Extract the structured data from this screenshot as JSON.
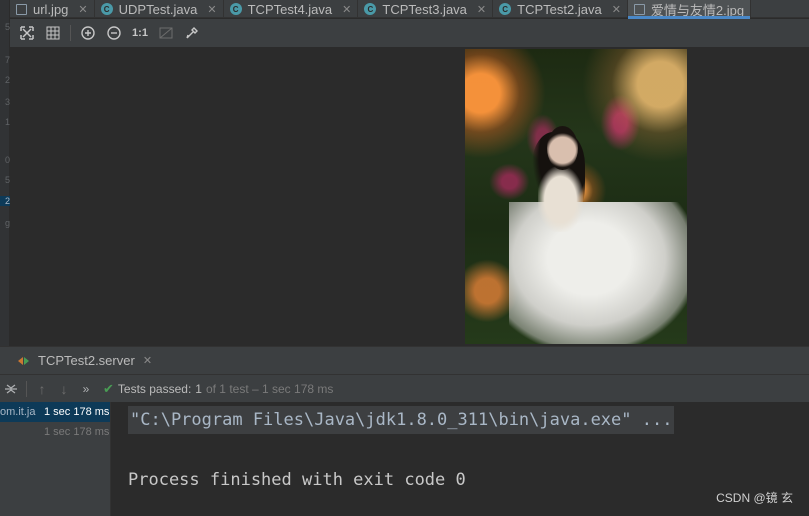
{
  "gutter": {
    "digits": [
      "5",
      "7",
      "2",
      "3",
      "1",
      "0",
      "5",
      "2",
      "g"
    ]
  },
  "tabs": [
    {
      "label": "url.jpg",
      "kind": "image",
      "active": false
    },
    {
      "label": "UDPTest.java",
      "kind": "java",
      "active": false
    },
    {
      "label": "TCPTest4.java",
      "kind": "java",
      "active": false
    },
    {
      "label": "TCPTest3.java",
      "kind": "java",
      "active": false
    },
    {
      "label": "TCPTest2.java",
      "kind": "java",
      "active": false
    },
    {
      "label": "爱情与友情2.jpg",
      "kind": "image",
      "active": true
    }
  ],
  "viewer_toolbar": {
    "actual_size_label": "1:1",
    "buttons": [
      "fit-screen-icon",
      "grid-icon",
      "zoom-in-icon",
      "zoom-out-icon",
      "actual-size",
      "background-icon",
      "color-picker-icon"
    ]
  },
  "run_panel": {
    "tab_label": "TCPTest2.server",
    "status": {
      "passed_label": "Tests passed:",
      "passed_count": "1",
      "rest": "of 1 test – 1 sec 178 ms"
    },
    "tree": [
      {
        "name": "om.it.ja",
        "time": "1 sec 178 ms",
        "selected": true
      },
      {
        "name": "",
        "time": "1 sec 178 ms",
        "selected": false
      }
    ],
    "console": {
      "command": "\"C:\\Program Files\\Java\\jdk1.8.0_311\\bin\\java.exe\" ...",
      "exit_line": "Process finished with exit code 0"
    }
  },
  "watermark": "CSDN @镜 玄",
  "colors": {
    "background": "#2b2b2b",
    "panel": "#3c3f41",
    "accent": "#4a88c7",
    "success": "#499c54",
    "java_icon": "#4a9aa8"
  }
}
